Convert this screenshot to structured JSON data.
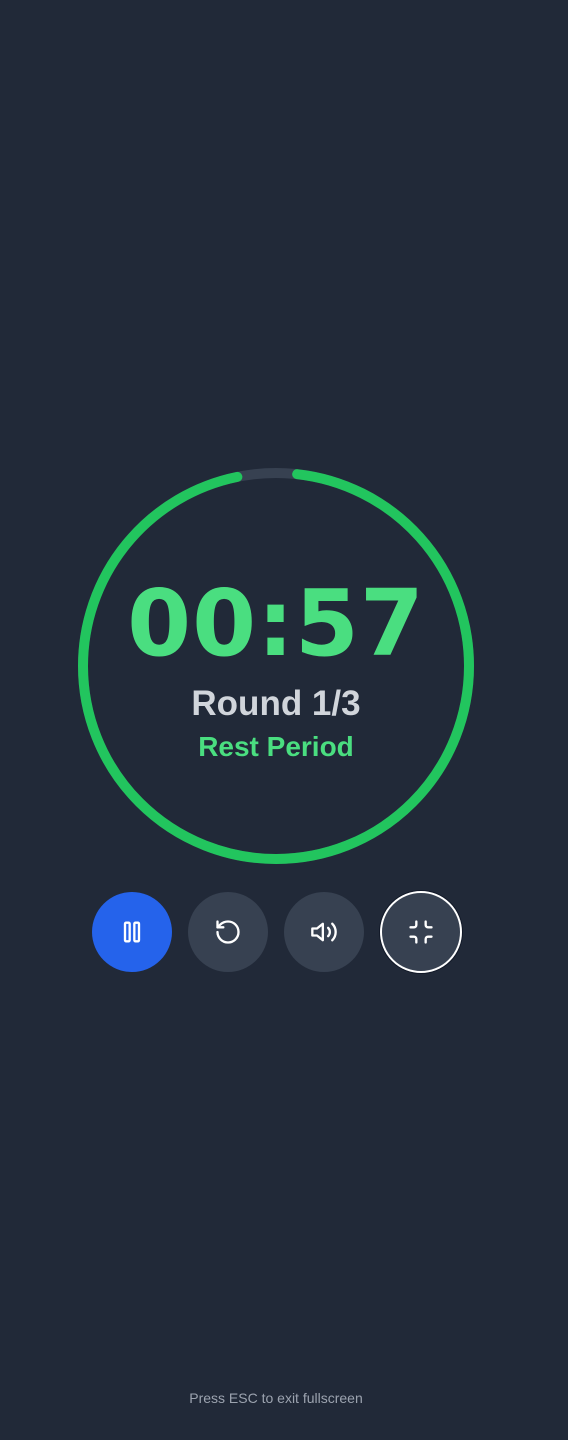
{
  "timer": {
    "time": "00:57",
    "round": "Round 1/3",
    "phase": "Rest Period",
    "progress_fraction": 0.95
  },
  "controls": {
    "pause": {
      "icon": "pause-icon"
    },
    "reset": {
      "icon": "reset-icon"
    },
    "sound": {
      "icon": "volume-icon"
    },
    "fullscreen": {
      "icon": "exit-fullscreen-icon"
    }
  },
  "hint": "Press ESC to exit fullscreen",
  "colors": {
    "background": "#212938",
    "accent_green": "#22c55e",
    "time_green": "#4ade80",
    "track": "#374151",
    "primary_button": "#2563eb",
    "secondary_button": "#374151"
  }
}
